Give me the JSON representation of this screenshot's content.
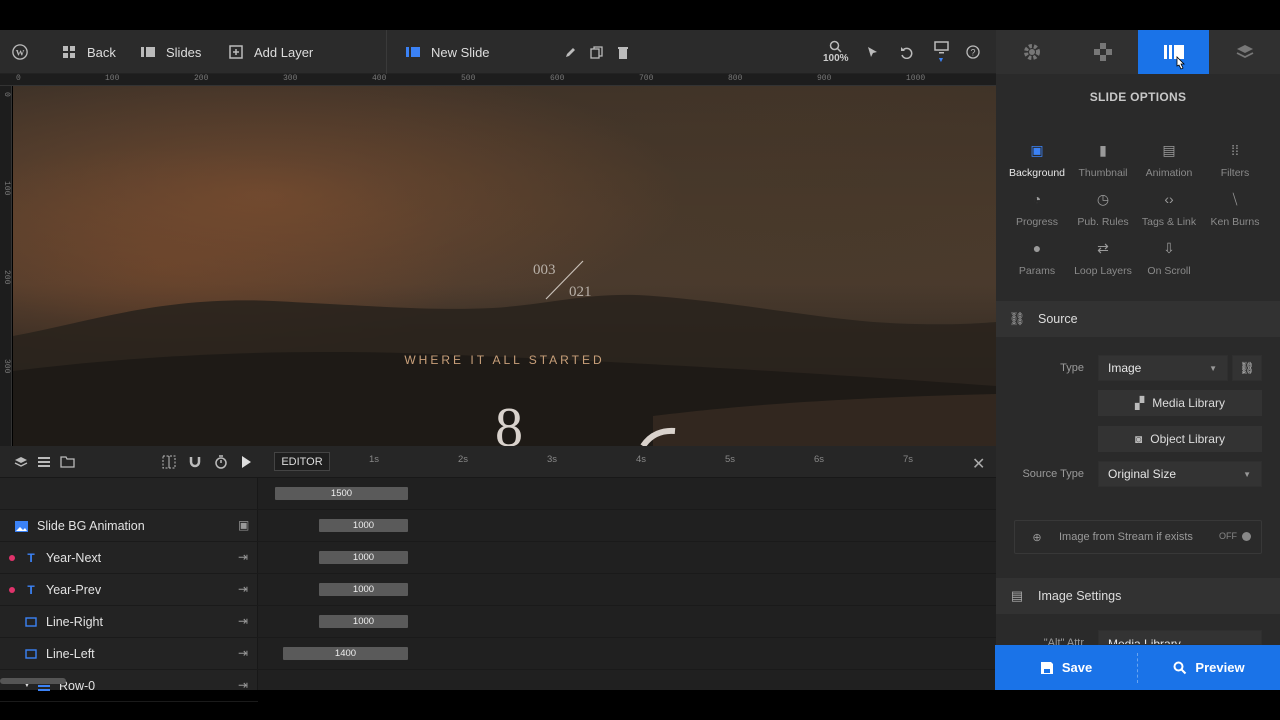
{
  "topbar": {
    "back_label": "Back",
    "slides_label": "Slides",
    "add_layer_label": "Add Layer",
    "slide_name": "New Slide",
    "zoom": "100%"
  },
  "ruler": {
    "top_ticks": [
      "0",
      "100",
      "200",
      "300",
      "400",
      "500",
      "600",
      "700",
      "800",
      "900",
      "1000"
    ],
    "left_ticks": [
      "0",
      "100",
      "200",
      "300"
    ]
  },
  "canvas": {
    "counter_current": "003",
    "counter_total": "021",
    "headline": "WHERE IT ALL STARTED"
  },
  "timeline": {
    "editor_label": "EDITOR",
    "time_ticks": [
      "1s",
      "2s",
      "3s",
      "4s",
      "5s",
      "6s",
      "7s"
    ],
    "layers": [
      {
        "name": "Slide BG Animation",
        "duration": "1500"
      },
      {
        "name": "Year-Next",
        "duration": "1000"
      },
      {
        "name": "Year-Prev",
        "duration": "1000"
      },
      {
        "name": "Line-Right",
        "duration": "1000"
      },
      {
        "name": "Line-Left",
        "duration": "1000"
      },
      {
        "name": "Row-0",
        "duration": "1400"
      }
    ]
  },
  "panel": {
    "title": "SLIDE OPTIONS",
    "options": [
      {
        "label": "Background",
        "icon": "image-icon"
      },
      {
        "label": "Thumbnail",
        "icon": "bookmark-icon"
      },
      {
        "label": "Animation",
        "icon": "film-icon"
      },
      {
        "label": "Filters",
        "icon": "grid-icon"
      },
      {
        "label": "Progress",
        "icon": "stopwatch-icon"
      },
      {
        "label": "Pub. Rules",
        "icon": "clock-icon"
      },
      {
        "label": "Tags & Link",
        "icon": "code-icon"
      },
      {
        "label": "Ken Burns",
        "icon": "ken-burns-icon"
      },
      {
        "label": "Params",
        "icon": "info-icon"
      },
      {
        "label": "Loop Layers",
        "icon": "loop-icon"
      },
      {
        "label": "On Scroll",
        "icon": "download-icon"
      }
    ],
    "source": {
      "section_title": "Source",
      "type_label": "Type",
      "type_value": "Image",
      "media_library": "Media Library",
      "object_library": "Object Library",
      "source_type_label": "Source Type",
      "source_type_value": "Original Size",
      "stream_label": "Image from Stream if exists",
      "stream_toggle": "OFF"
    },
    "image_settings": {
      "section_title": "Image Settings",
      "alt_label": "\"Alt\" Attr",
      "alt_value": "Media Library"
    },
    "save_label": "Save",
    "preview_label": "Preview"
  },
  "colors": {
    "accent": "#1a73e8",
    "keyframe_dot": "#e0336b"
  }
}
